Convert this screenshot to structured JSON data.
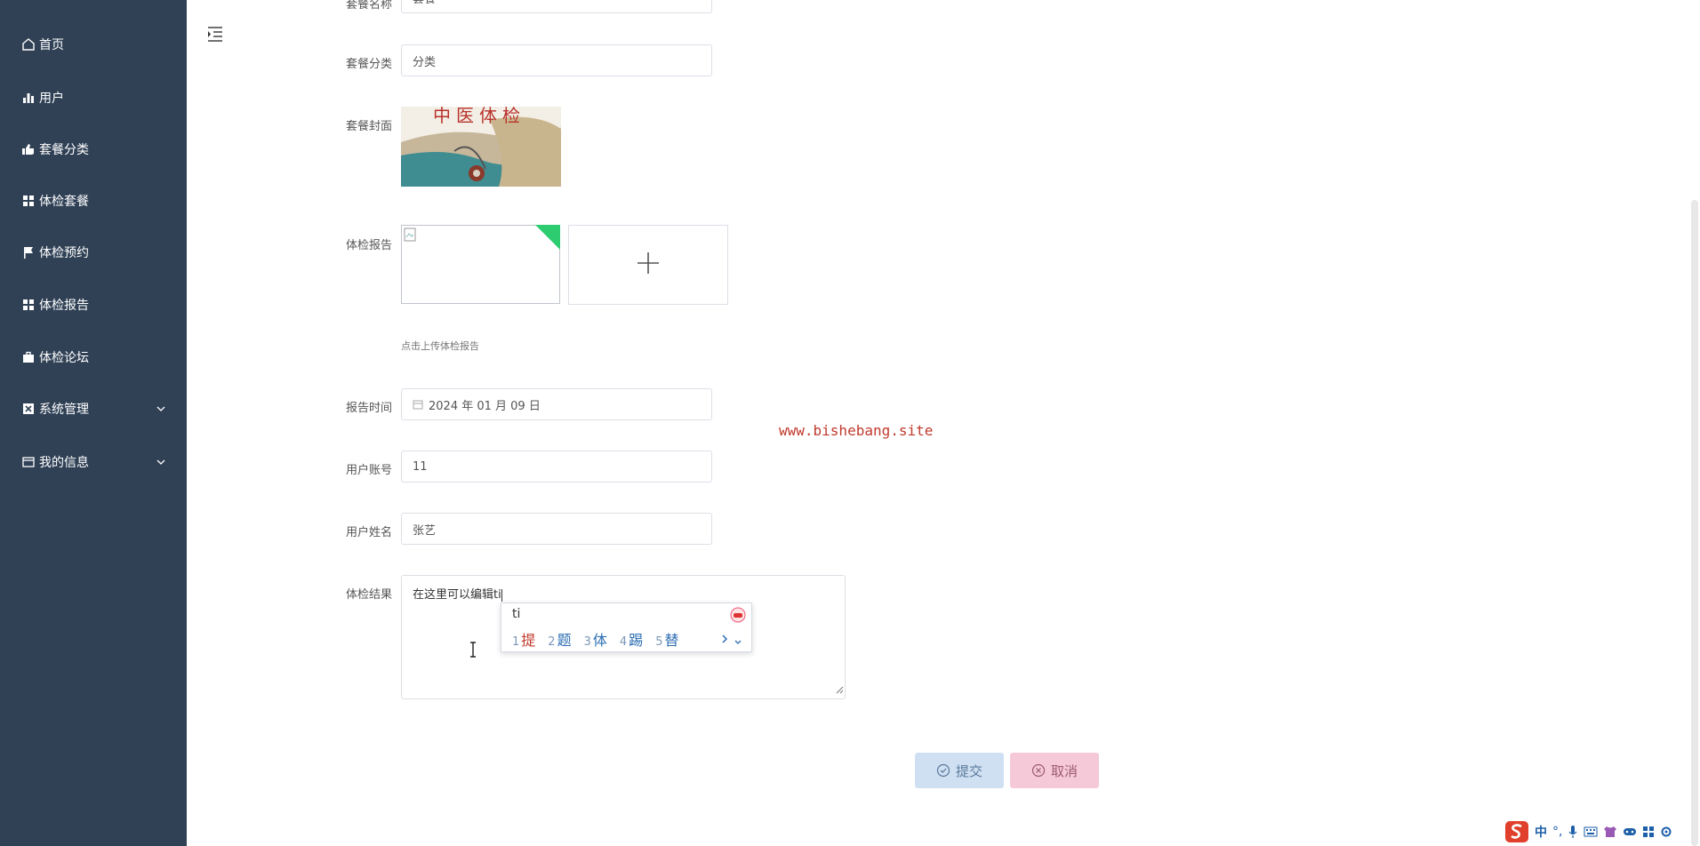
{
  "sidebar": {
    "items": [
      {
        "label": "首页",
        "icon": "home-icon"
      },
      {
        "label": "用户",
        "icon": "bar-chart-icon"
      },
      {
        "label": "套餐分类",
        "icon": "thumbs-up-icon"
      },
      {
        "label": "体检套餐",
        "icon": "grid-icon"
      },
      {
        "label": "体检预约",
        "icon": "flag-icon"
      },
      {
        "label": "体检报告",
        "icon": "grid-icon"
      },
      {
        "label": "体检论坛",
        "icon": "briefcase-icon"
      },
      {
        "label": "系统管理",
        "icon": "settings-box-icon"
      },
      {
        "label": "我的信息",
        "icon": "window-icon"
      }
    ]
  },
  "form": {
    "name_label": "套餐名称",
    "name_value": "套餐",
    "category_label": "套餐分类",
    "category_value": "分类",
    "cover_label": "套餐封面",
    "cover_text": "中医体检",
    "report_label": "体检报告",
    "upload_hint": "点击上传体检报告",
    "time_label": "报告时间",
    "time_value": "2024 年 01 月 09 日",
    "account_label": "用户账号",
    "account_value": "11",
    "username_label": "用户姓名",
    "username_value": "张艺",
    "result_label": "体检结果",
    "result_value": "在这里可以编辑ti"
  },
  "watermark": "www.bishebang.site",
  "ime": {
    "pinyin": "ti",
    "candidates": [
      {
        "num": "1",
        "char": "提"
      },
      {
        "num": "2",
        "char": "题"
      },
      {
        "num": "3",
        "char": "体"
      },
      {
        "num": "4",
        "char": "踢"
      },
      {
        "num": "5",
        "char": "替"
      }
    ]
  },
  "buttons": {
    "submit": "提交",
    "cancel": "取消"
  },
  "tray": {
    "ime_mode": "中"
  },
  "colors": {
    "sidebar_bg": "#304156",
    "submit_bg": "#cfe0f3",
    "cancel_bg": "#f6c9d8",
    "watermark": "#c0392b"
  }
}
